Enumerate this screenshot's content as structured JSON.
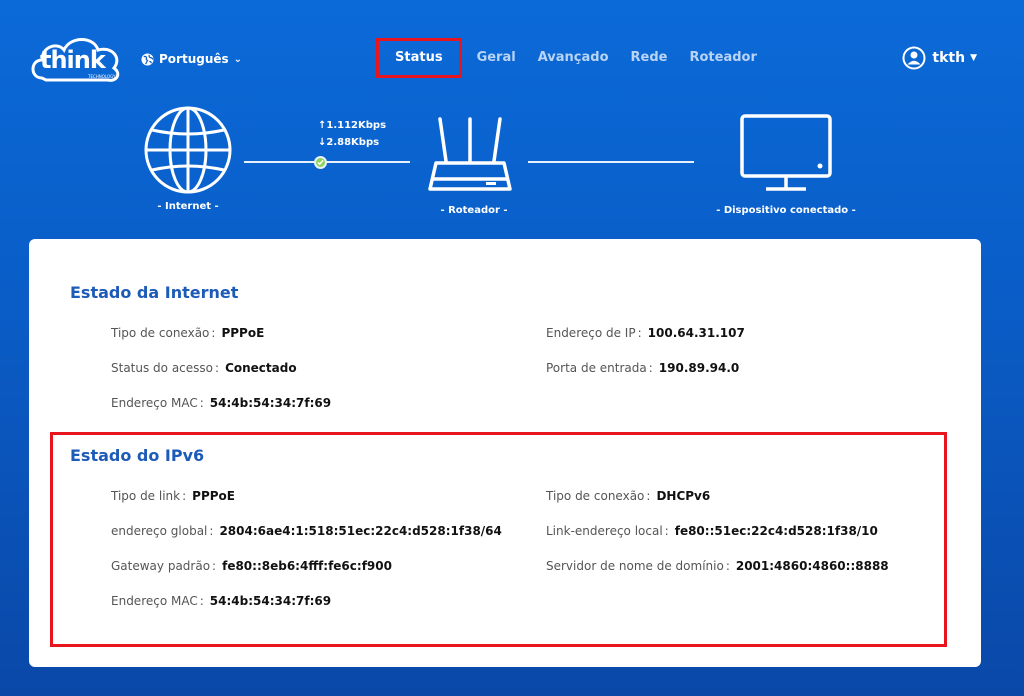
{
  "header": {
    "logo_text": "think",
    "logo_sub": "TECHNOLOGY",
    "language": "Português",
    "user": "tkth"
  },
  "nav": {
    "items": [
      "Status",
      "Geral",
      "Avançado",
      "Rede",
      "Roteador"
    ],
    "active_index": 0
  },
  "topology": {
    "internet_label": "- Internet -",
    "router_label": "- Roteador -",
    "device_label": "- Dispositivo conectado -",
    "upload": "↑1.112Kbps",
    "download": "↓2.88Kbps"
  },
  "internet_status": {
    "title": "Estado da Internet",
    "left": [
      {
        "label": "Tipo de conexão",
        "value": "PPPoE"
      },
      {
        "label": "Status do acesso",
        "value": "Conectado"
      },
      {
        "label": "Endereço MAC",
        "value": "54:4b:54:34:7f:69"
      }
    ],
    "right": [
      {
        "label": "Endereço de IP",
        "value": "100.64.31.107"
      },
      {
        "label": "Porta de entrada",
        "value": "190.89.94.0"
      }
    ]
  },
  "ipv6_status": {
    "title": "Estado do IPv6",
    "left": [
      {
        "label": "Tipo de link",
        "value": "PPPoE"
      },
      {
        "label": "endereço global",
        "value": "2804:6ae4:1:518:51ec:22c4:d528:1f38/64"
      },
      {
        "label": "Gateway padrão",
        "value": "fe80::8eb6:4fff:fe6c:f900"
      },
      {
        "label": "Endereço MAC",
        "value": "54:4b:54:34:7f:69"
      }
    ],
    "right": [
      {
        "label": "Tipo de conexão",
        "value": "DHCPv6"
      },
      {
        "label": "Link-endereço local",
        "value": "fe80::51ec:22c4:d528:1f38/10"
      },
      {
        "label": "Servidor de nome de domínio",
        "value": "2001:4860:4860::8888"
      }
    ]
  },
  "colors": {
    "background": "#0a5cc6",
    "accent_title": "#1d5bb8",
    "highlight_border": "#e8141e",
    "link_dot": "#8fd35a"
  }
}
